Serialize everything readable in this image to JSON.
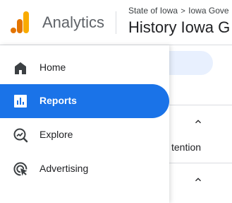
{
  "header": {
    "app_title": "Analytics",
    "breadcrumb": {
      "account": "State of Iowa",
      "separator": ">",
      "property_parent": "Iowa Gove"
    },
    "property_name": "History Iowa G"
  },
  "nav": {
    "items": [
      {
        "label": "Home",
        "icon": "home-icon",
        "active": false
      },
      {
        "label": "Reports",
        "icon": "reports-icon",
        "active": true
      },
      {
        "label": "Explore",
        "icon": "explore-icon",
        "active": false
      },
      {
        "label": "Advertising",
        "icon": "advertising-icon",
        "active": false
      }
    ]
  },
  "background": {
    "partial_text": "tention"
  },
  "colors": {
    "accent": "#1a73e8",
    "logo_orange": "#f9ab00",
    "logo_dark_orange": "#e37400",
    "text_primary": "#202124",
    "text_secondary": "#5f6368",
    "icon_gray": "#5f6368"
  }
}
